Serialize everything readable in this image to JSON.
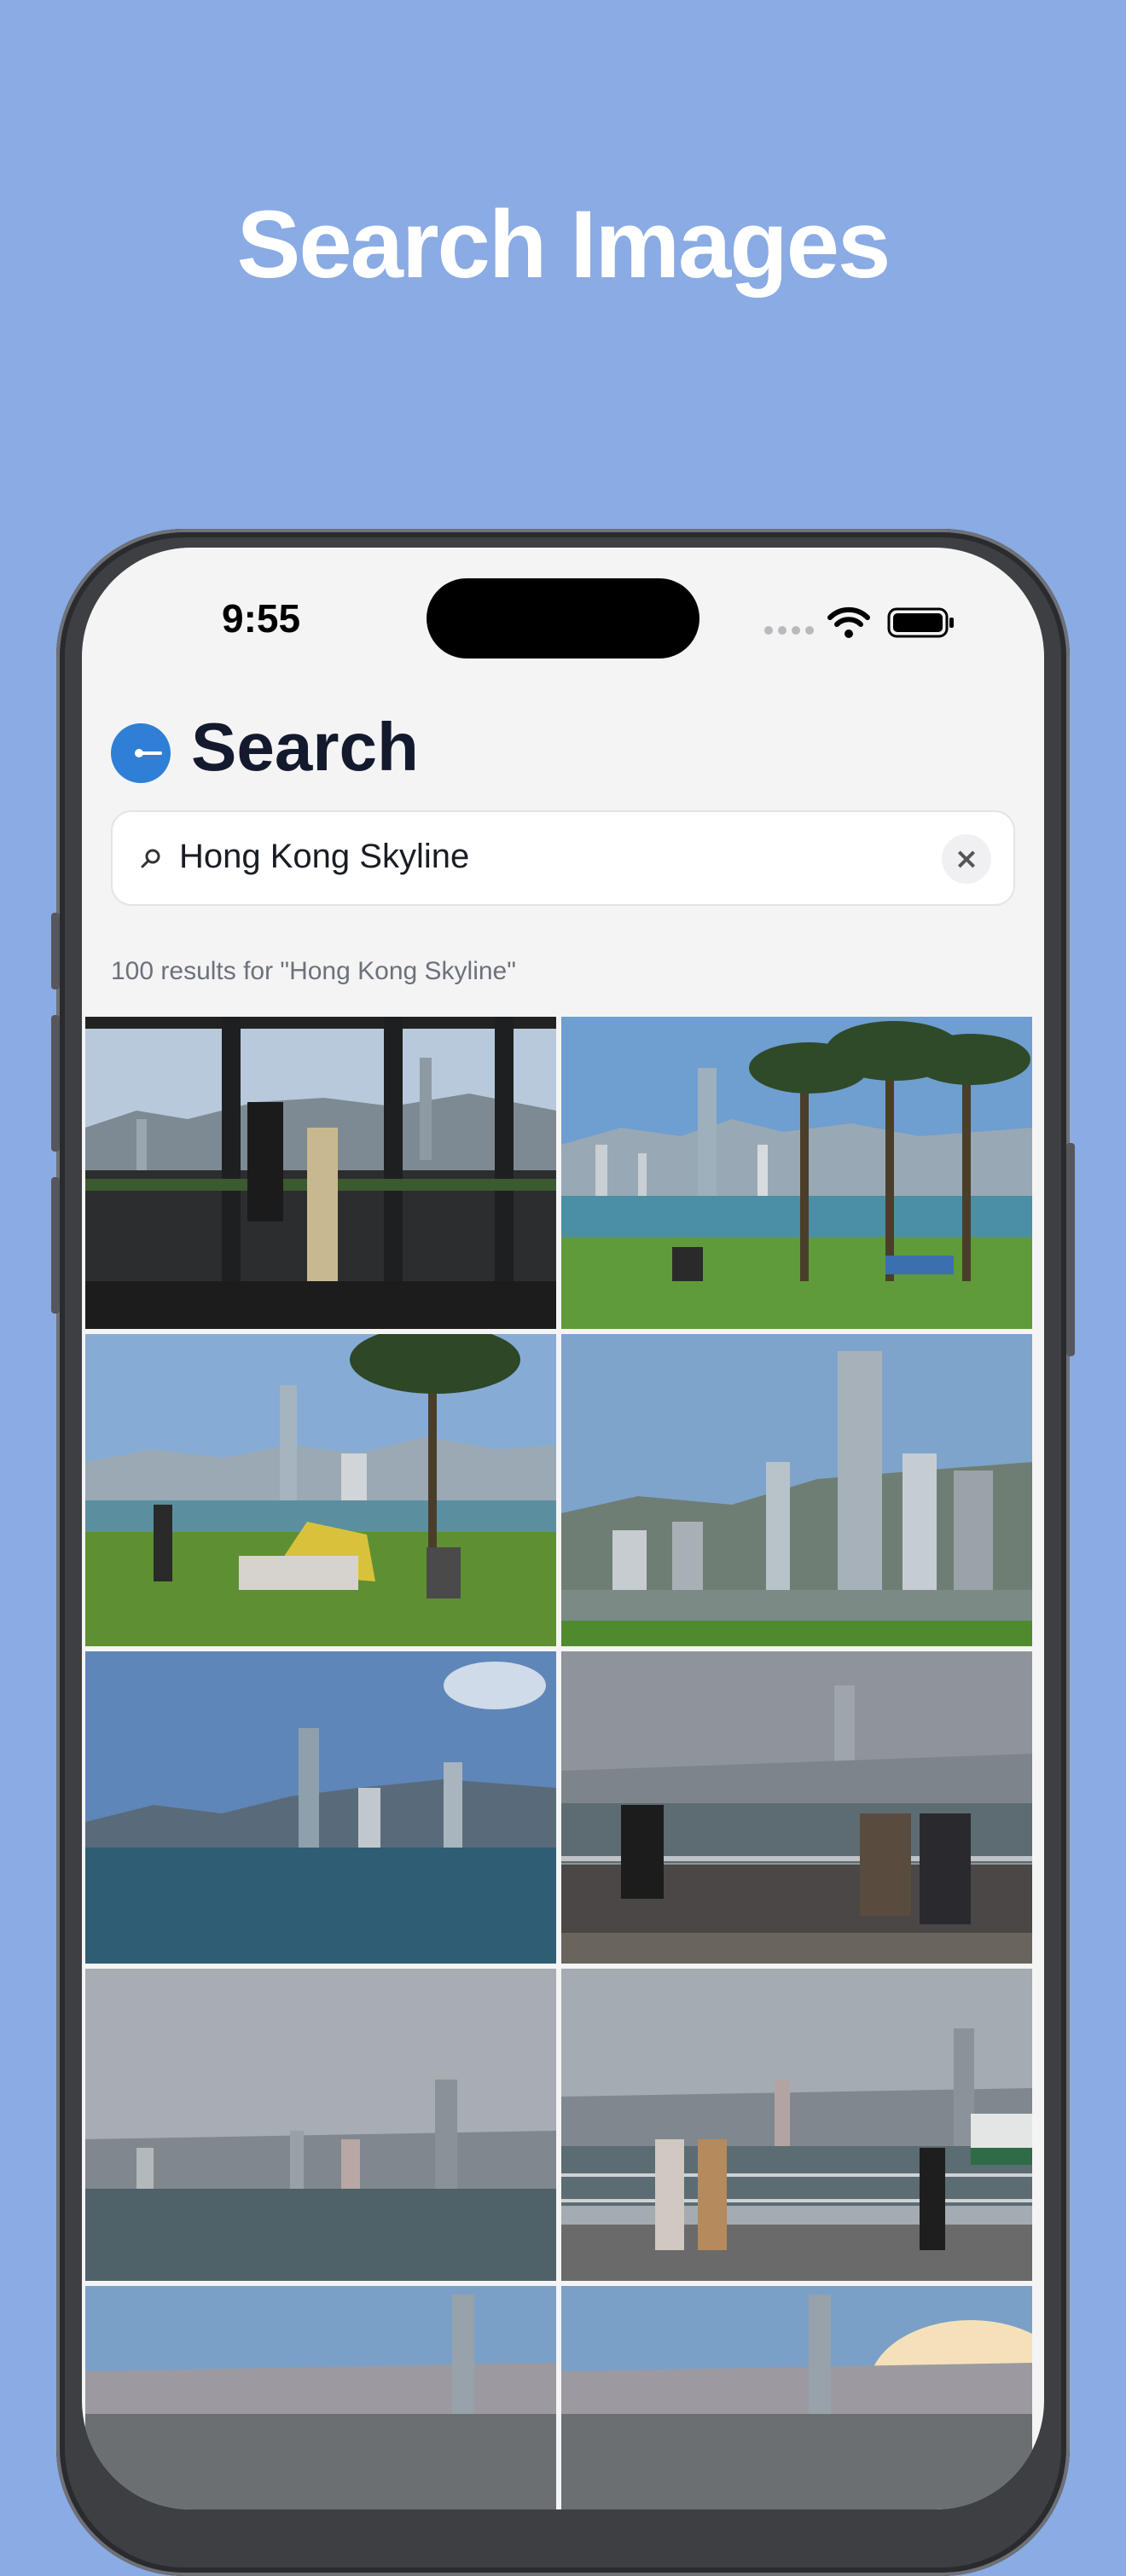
{
  "promo": {
    "headline": "Search Images"
  },
  "status_bar": {
    "time": "9:55"
  },
  "header": {
    "title": "Search",
    "logo_icon": "app-logo-icon"
  },
  "search": {
    "query": "Hong Kong Skyline",
    "search_icon": "search-icon",
    "clear_icon": "close-icon",
    "clear_glyph": "×"
  },
  "results": {
    "count_text": "100 results for \"Hong Kong Skyline\""
  },
  "photos": [
    {
      "scene": "indoor-window"
    },
    {
      "scene": "palms-harbour"
    },
    {
      "scene": "picnic-harbour"
    },
    {
      "scene": "tower-closeup"
    },
    {
      "scene": "open-water"
    },
    {
      "scene": "foggy-railing"
    },
    {
      "scene": "foggy-water"
    },
    {
      "scene": "foggy-promenade"
    },
    {
      "scene": "sunset-left"
    },
    {
      "scene": "sunset-right"
    }
  ],
  "colors": {
    "background": "#8AABE3",
    "accent": "#2F7FD6",
    "screen": "#F4F4F5"
  }
}
